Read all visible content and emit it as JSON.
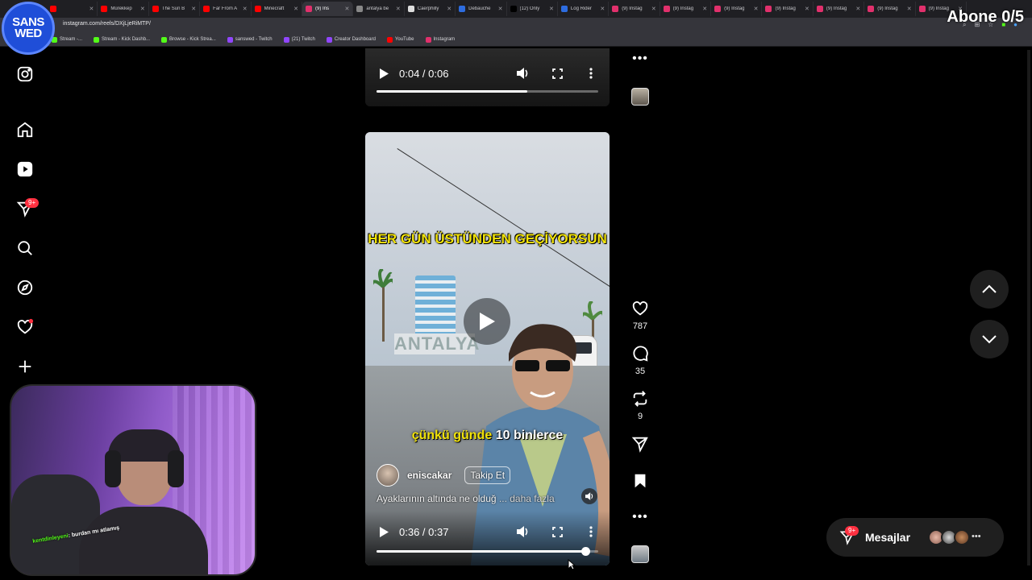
{
  "browser": {
    "tabs": [
      {
        "label": "",
        "color": "#ff0000"
      },
      {
        "label": "Mürekkep",
        "color": "#ff0000"
      },
      {
        "label": "The Sun B",
        "color": "#ff0000"
      },
      {
        "label": "Far From A",
        "color": "#ff0000"
      },
      {
        "label": "Minecraft",
        "color": "#ff0000"
      },
      {
        "label": "(9) Ins",
        "color": "#e1306c",
        "active": true
      },
      {
        "label": "antalya be",
        "color": "#888888"
      },
      {
        "label": "Caerphilly",
        "color": "#dddddd"
      },
      {
        "label": "Debauche",
        "color": "#2d6cdf"
      },
      {
        "label": "(12) Only",
        "color": "#000000"
      },
      {
        "label": "Log Rider",
        "color": "#2d6cdf"
      },
      {
        "label": "(9) Instag",
        "color": "#e1306c"
      },
      {
        "label": "(9) Instag",
        "color": "#e1306c"
      },
      {
        "label": "(9) Instag",
        "color": "#e1306c"
      },
      {
        "label": "(9) Instag",
        "color": "#e1306c"
      },
      {
        "label": "(9) Instag",
        "color": "#e1306c"
      },
      {
        "label": "(9) Instag",
        "color": "#e1306c"
      },
      {
        "label": "(9) Instag",
        "color": "#e1306c"
      }
    ],
    "url": "instagram.com/reels/DXjLjeRiMTP/",
    "bookmarks": [
      {
        "label": "Stream -...",
        "color": "#53fc18"
      },
      {
        "label": "Stream - Kick Dashb...",
        "color": "#53fc18"
      },
      {
        "label": "Browse - Kick Strea...",
        "color": "#53fc18"
      },
      {
        "label": "sanswed - Twitch",
        "color": "#9146ff"
      },
      {
        "label": "(21) Twitch",
        "color": "#9146ff"
      },
      {
        "label": "Creator Dashboard",
        "color": "#9146ff"
      },
      {
        "label": "YouTube",
        "color": "#ff0000"
      },
      {
        "label": "Instagram",
        "color": "#e1306c"
      }
    ]
  },
  "overlay": {
    "logo_line1": "SANS",
    "logo_line2": "WED",
    "sub_counter": "Abone 0/5"
  },
  "sidebar": {
    "notifications_badge": "9+",
    "icons": [
      "instagram-logo-icon",
      "home-icon",
      "reels-icon",
      "messages-icon",
      "search-icon",
      "explore-icon",
      "notifications-icon",
      "create-icon"
    ]
  },
  "reel_previous": {
    "time": "0:04 / 0:06",
    "progress": 0.68
  },
  "reel_current": {
    "caption_top": "HER GÜN ÜSTÜNDEN GEÇİYORSUN",
    "caption_yellow": "çünkü günde",
    "caption_white": "10 binlerce",
    "sign_text": "ANTALYA",
    "username": "eniscakar",
    "follow_label": "Takip Et",
    "description": "Ayaklarının altında ne olduğ",
    "more_label": "... daha fazla",
    "time": "0:36 / 0:37",
    "progress": 0.94
  },
  "actions": {
    "likes": "787",
    "comments": "35",
    "reposts": "9"
  },
  "messages": {
    "label": "Mesajlar",
    "badge": "9+"
  },
  "webcam": {
    "chat_user": "kentdinleyeni",
    "chat_message": ": burdan mı atlamış"
  },
  "colors": {
    "brand_blue": "#1f4ed8",
    "kick_green": "#53fc18",
    "notification_red": "#ff3040",
    "caption_yellow": "#f2e30a"
  }
}
